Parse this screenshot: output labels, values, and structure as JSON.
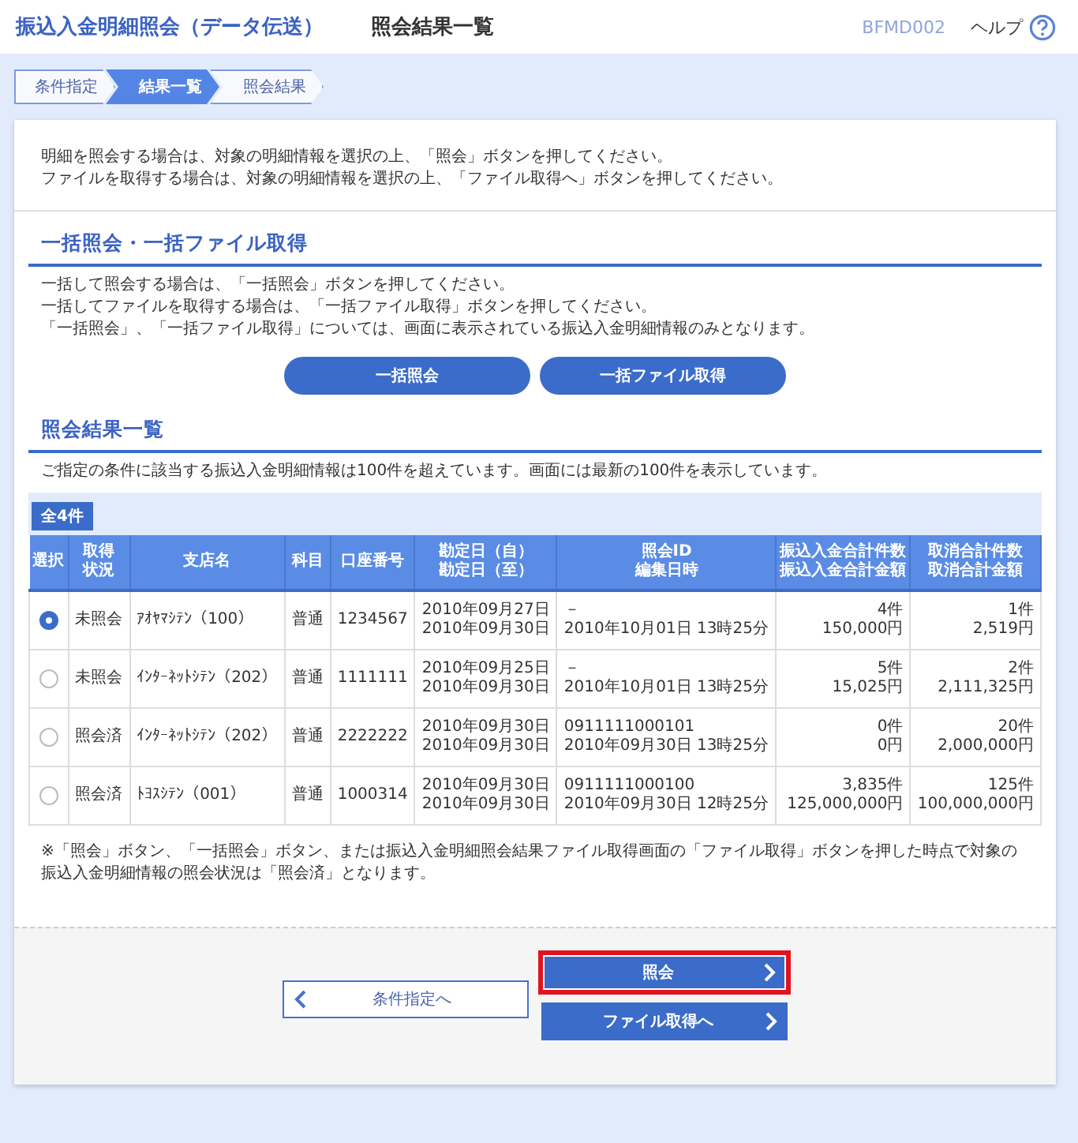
{
  "header": {
    "title": "振込入金明細照会（データ伝送）",
    "subtitle": "照会結果一覧",
    "screen_id": "BFMD002",
    "help": "ヘルプ"
  },
  "steps": [
    {
      "label": "条件指定",
      "selected": false
    },
    {
      "label": "結果一覧",
      "selected": true
    },
    {
      "label": "照会結果",
      "selected": false
    }
  ],
  "intro": [
    "明細を照会する場合は、対象の明細情報を選択の上、「照会」ボタンを押してください。",
    "ファイルを取得する場合は、対象の明細情報を選択の上、「ファイル取得へ」ボタンを押してください。"
  ],
  "bulk": {
    "heading": "一括照会・一括ファイル取得",
    "lines": [
      "一括して照会する場合は、「一括照会」ボタンを押してください。",
      "一括してファイルを取得する場合は、「一括ファイル取得」ボタンを押してください。",
      "「一括照会」、「一括ファイル取得」については、画面に表示されている振込入金明細情報のみとなります。"
    ],
    "buttons": [
      "一括照会",
      "一括ファイル取得"
    ]
  },
  "results": {
    "heading": "照会結果一覧",
    "notice": "ご指定の条件に該当する振込入金明細情報は100件を超えています。画面には最新の100件を表示しています。",
    "count": "全4件",
    "columns": [
      [
        "選択"
      ],
      [
        "取得状況"
      ],
      [
        "支店名"
      ],
      [
        "科目"
      ],
      [
        "口座番号"
      ],
      [
        "勘定日（自）",
        "勘定日（至）"
      ],
      [
        "照会ID",
        "編集日時"
      ],
      [
        "振込入金合計件数",
        "振込入金合計金額"
      ],
      [
        "取消合計件数",
        "取消合計金額"
      ]
    ],
    "rows": [
      {
        "selected": true,
        "status": "未照会",
        "branch": "ｱｵﾔﾏｼﾃﾝ（100）",
        "subject": "普通",
        "account": "1234567",
        "date_from": "2010年09月27日",
        "date_to": "2010年09月30日",
        "inquiry_id": "－",
        "edited_at": "2010年10月01日 13時25分",
        "transfer_count": "4件",
        "transfer_amount": "150,000円",
        "cancel_count": "1件",
        "cancel_amount": "2,519円"
      },
      {
        "selected": false,
        "status": "未照会",
        "branch": "ｲﾝﾀｰﾈｯﾄｼﾃﾝ（202）",
        "subject": "普通",
        "account": "1111111",
        "date_from": "2010年09月25日",
        "date_to": "2010年09月30日",
        "inquiry_id": "－",
        "edited_at": "2010年10月01日 13時25分",
        "transfer_count": "5件",
        "transfer_amount": "15,025円",
        "cancel_count": "2件",
        "cancel_amount": "2,111,325円"
      },
      {
        "selected": false,
        "status": "照会済",
        "branch": "ｲﾝﾀｰﾈｯﾄｼﾃﾝ（202）",
        "subject": "普通",
        "account": "2222222",
        "date_from": "2010年09月30日",
        "date_to": "2010年09月30日",
        "inquiry_id": "0911111000101",
        "edited_at": "2010年09月30日 13時25分",
        "transfer_count": "0件",
        "transfer_amount": "0円",
        "cancel_count": "20件",
        "cancel_amount": "2,000,000円"
      },
      {
        "selected": false,
        "status": "照会済",
        "branch": "ﾄﾖｽｼﾃﾝ（001）",
        "subject": "普通",
        "account": "1000314",
        "date_from": "2010年09月30日",
        "date_to": "2010年09月30日",
        "inquiry_id": "0911111000100",
        "edited_at": "2010年09月30日 12時25分",
        "transfer_count": "3,835件",
        "transfer_amount": "125,000,000円",
        "cancel_count": "125件",
        "cancel_amount": "100,000,000円"
      }
    ],
    "note": "※「照会」ボタン、「一括照会」ボタン、または振込入金明細照会結果ファイル取得画面の「ファイル取得」ボタンを押した時点で対象の振込入金明細情報の照会状況は「照会済」となります。"
  },
  "footer_buttons": [
    {
      "kind": "back",
      "label": "条件指定へ",
      "highlighted": false
    },
    {
      "kind": "forward",
      "label": "照会",
      "highlighted": true
    },
    {
      "kind": "forward",
      "label": "ファイル取得へ",
      "highlighted": false
    }
  ]
}
